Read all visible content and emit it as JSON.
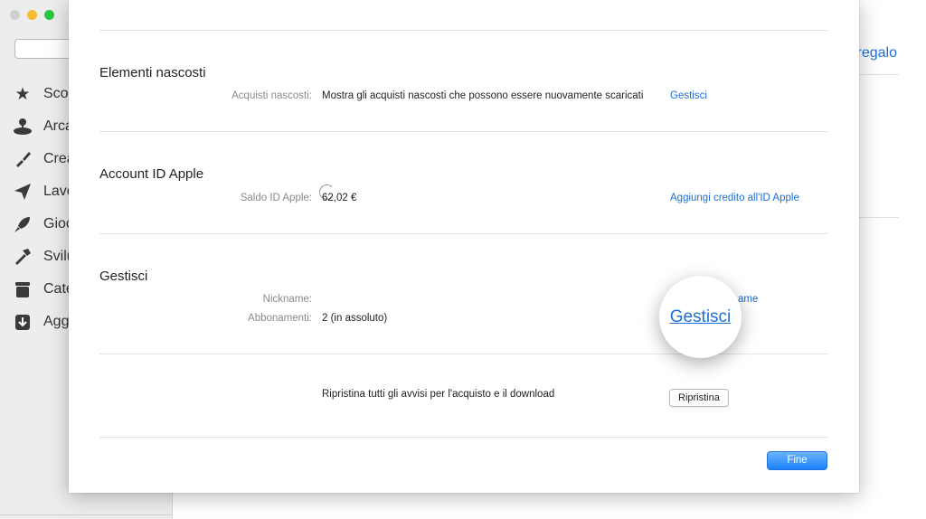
{
  "background": {
    "search_icon": "search-icon",
    "sidebar_items": [
      {
        "label": "Scopri",
        "icon": "star-icon"
      },
      {
        "label": "Arcade",
        "icon": "joystick-icon"
      },
      {
        "label": "Crea",
        "icon": "brush-icon"
      },
      {
        "label": "Lavora",
        "icon": "paper-plane-icon"
      },
      {
        "label": "Gioca",
        "icon": "rocket-icon"
      },
      {
        "label": "Sviluppa",
        "icon": "hammer-icon"
      },
      {
        "label": "Categorie",
        "icon": "box-icon"
      },
      {
        "label": "Aggiornamenti",
        "icon": "download-icon"
      }
    ],
    "right_link": "regalo"
  },
  "sheet": {
    "hidden": {
      "title": "Elementi nascosti",
      "label": "Acquisti nascosti:",
      "value": "Mostra gli acquisti nascosti che possono essere nuovamente scaricati",
      "action": "Gestisci"
    },
    "account": {
      "title": "Account ID Apple",
      "label": "Saldo ID Apple:",
      "value": "62,02 €",
      "action": "Aggiungi credito all'ID Apple"
    },
    "manage": {
      "title": "Gestisci",
      "nickname_label": "Nickname:",
      "nickname_action": "ame",
      "subs_label": "Abbonamenti:",
      "subs_value": "2 (in assoluto)",
      "subs_action": "Gestisci"
    },
    "reset": {
      "text": "Ripristina tutti gli avvisi per l'acquisto e il download",
      "button": "Ripristina"
    },
    "done_button": "Fine"
  },
  "colors": {
    "accent": "#1d6fd6",
    "primary_button": "#1a82fb"
  }
}
